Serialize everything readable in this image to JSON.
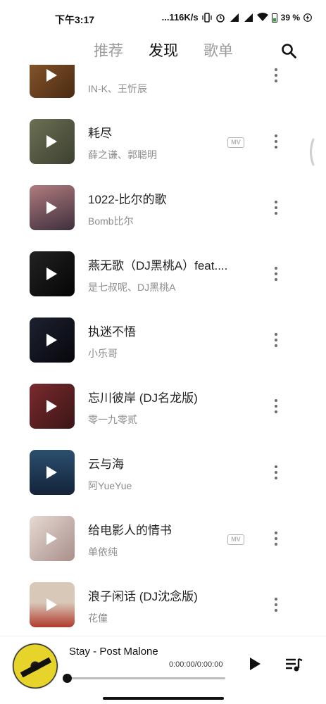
{
  "status_bar": {
    "time": "下午3:17",
    "network_speed": "...116K/s",
    "battery": "39 %"
  },
  "header": {
    "tabs": [
      "推荐",
      "发现",
      "歌单"
    ],
    "active_tab": "发现",
    "search_icon": "search-icon"
  },
  "songs": [
    {
      "title": "",
      "artist": "IN-K、王忻辰",
      "has_mv": false,
      "cover_colors": [
        "#8a5a2e",
        "#4a2a12"
      ]
    },
    {
      "title": "耗尽",
      "artist": "薛之谦、郭聪明",
      "has_mv": true,
      "cover_colors": [
        "#6b7054",
        "#3c4030"
      ]
    },
    {
      "title": "1022-比尔的歌",
      "artist": "Bomb比尔",
      "has_mv": false,
      "cover_colors": [
        "#b07b7e",
        "#3e2f3d"
      ]
    },
    {
      "title": "燕无歌（DJ黑桃A）feat....",
      "artist": "是七叔呢、DJ黑桃A",
      "has_mv": false,
      "cover_colors": [
        "#222222",
        "#050505"
      ]
    },
    {
      "title": "执迷不悟",
      "artist": "小乐哥",
      "has_mv": false,
      "cover_colors": [
        "#1d2130",
        "#07070c"
      ]
    },
    {
      "title": "忘川彼岸 (DJ名龙版)",
      "artist": "零一九零贰",
      "has_mv": false,
      "cover_colors": [
        "#7a2a2e",
        "#3b1516"
      ]
    },
    {
      "title": "云与海",
      "artist": "阿YueYue",
      "has_mv": false,
      "cover_colors": [
        "#2c4f6e",
        "#13233a"
      ]
    },
    {
      "title": "给电影人的情书",
      "artist": "单依纯",
      "has_mv": true,
      "cover_colors": [
        "#e6d9d3",
        "#a98f8a"
      ]
    },
    {
      "title": "浪子闲话 (DJ沈念版)",
      "artist": "花僮",
      "has_mv": false,
      "cover_colors": [
        "#d8c8b8",
        "#b23a2e"
      ]
    }
  ],
  "mv_label": "MV",
  "now_playing": {
    "title": "Stay - Post Malone",
    "time": "0:00:00/0:00:00",
    "progress": 0
  }
}
